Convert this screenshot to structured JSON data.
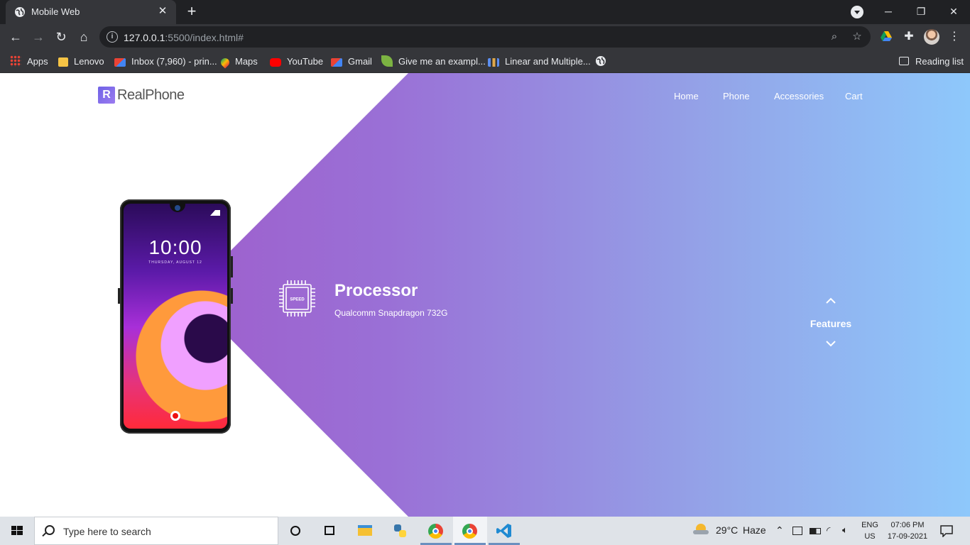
{
  "browser": {
    "tab_title": "Mobile Web",
    "tab_close": "✕",
    "new_tab": "+",
    "url_host": "127.0.0.1",
    "url_rest": ":5500/index.html#",
    "window_controls": {
      "minimize": "─",
      "restore": "❐",
      "close": "✕"
    },
    "toolbar_icons": {
      "back": "←",
      "forward": "→",
      "reload": "↻",
      "home": "⌂",
      "zoom": "⌕",
      "star": "☆",
      "extensions": "✚"
    },
    "bookmarks": [
      {
        "label": "Apps",
        "icon": "apps-grid-icon"
      },
      {
        "label": "Lenovo",
        "icon": "folder-icon"
      },
      {
        "label": "Inbox (7,960) - prin...",
        "icon": "gmail-icon"
      },
      {
        "label": "Maps",
        "icon": "maps-icon"
      },
      {
        "label": "YouTube",
        "icon": "youtube-icon"
      },
      {
        "label": "Gmail",
        "icon": "gmail-icon"
      },
      {
        "label": "Give me an exampl...",
        "icon": "leaf-icon"
      },
      {
        "label": "Linear and Multiple...",
        "icon": "chart-icon"
      }
    ],
    "reading_list": "Reading list"
  },
  "site": {
    "logo_mark": "R",
    "logo_name": "RealPhone",
    "nav": [
      "Home",
      "Phone",
      "Accessories",
      "Cart"
    ],
    "phone_clock": "10:00",
    "phone_clock_sub": "THURSDAY, AUGUST 12",
    "feature": {
      "chip_label": "SPEED",
      "title": "Processor",
      "subtitle": "Qualcomm Snapdragon 732G"
    },
    "features_label": "Features",
    "colors": {
      "gradient_start": "#a24fc4",
      "gradient_end": "#8ec8fb"
    }
  },
  "taskbar": {
    "search_placeholder": "Type here to search",
    "weather_temp": "29°C",
    "weather_text": "Haze",
    "lang_top": "ENG",
    "lang_bottom": "US",
    "time": "07:06 PM",
    "date": "17-09-2021"
  }
}
